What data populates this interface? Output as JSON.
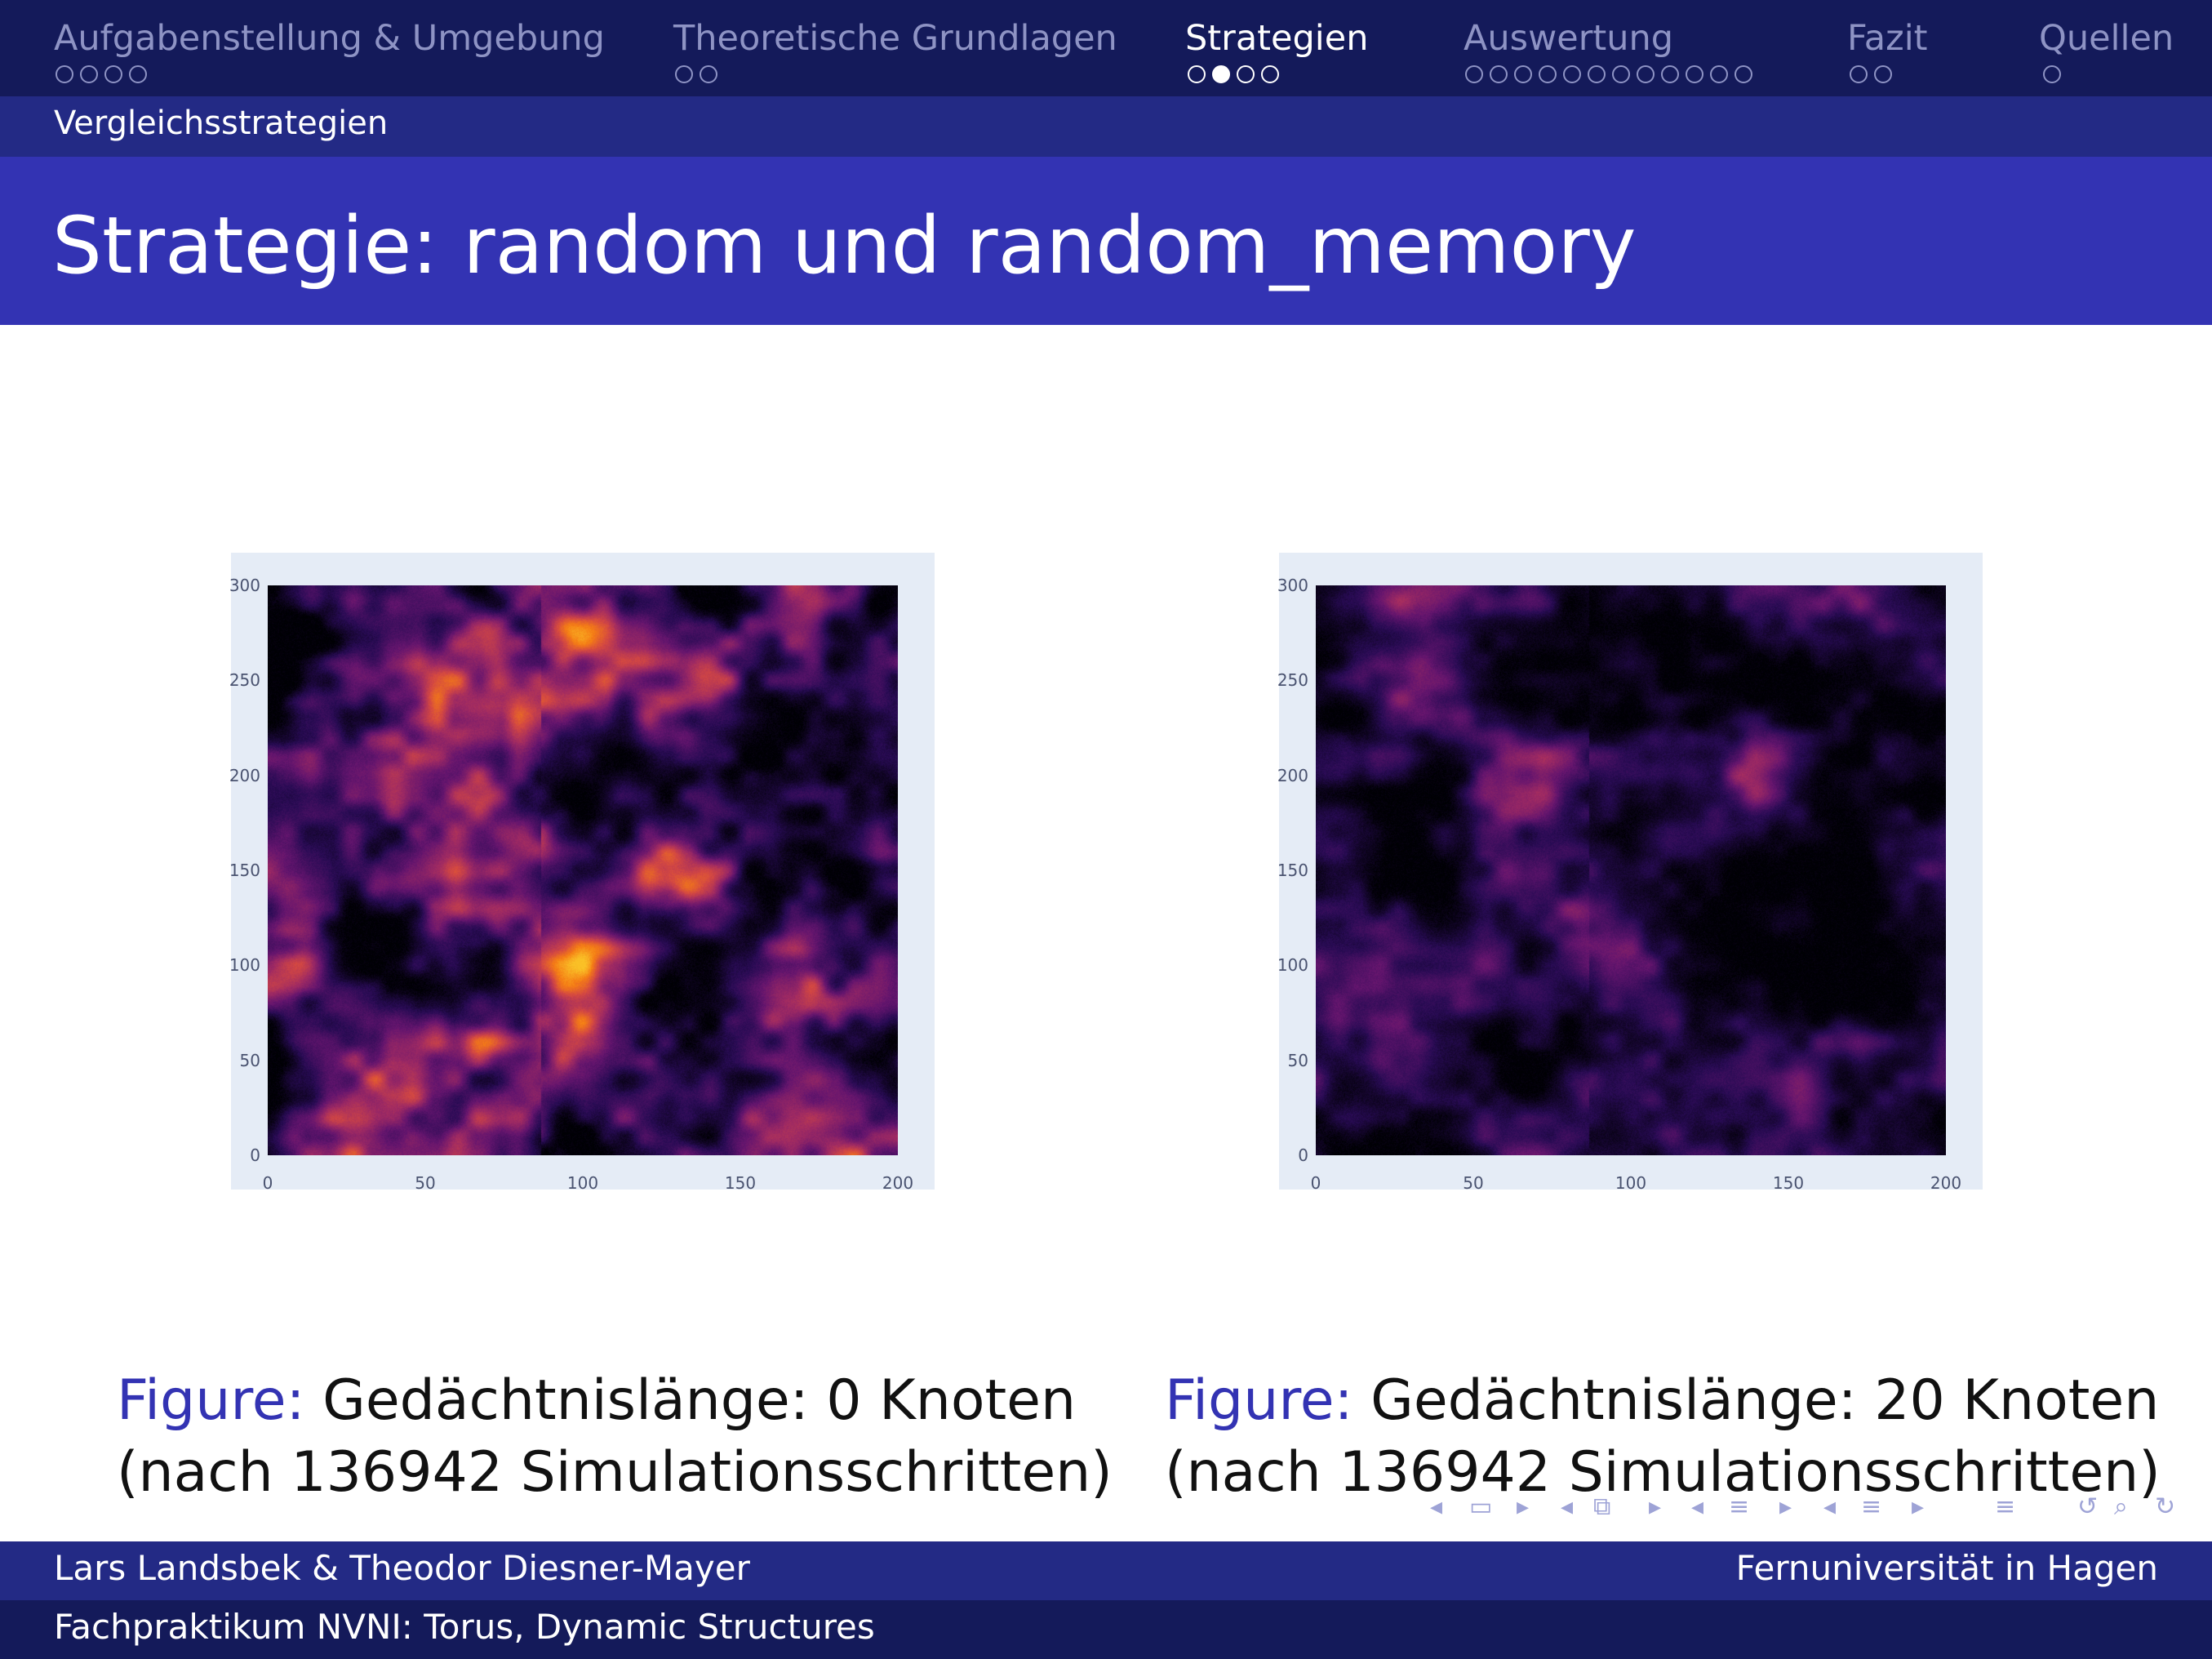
{
  "nav": {
    "sections": [
      {
        "label": "Aufgabenstellung & Umgebung",
        "dots": 4,
        "filled": -1,
        "active": false
      },
      {
        "label": "Theoretische Grundlagen",
        "dots": 2,
        "filled": -1,
        "active": false
      },
      {
        "label": "Strategien",
        "dots": 4,
        "filled": 1,
        "active": true
      },
      {
        "label": "Auswertung",
        "dots": 12,
        "filled": -1,
        "active": false
      },
      {
        "label": "Fazit",
        "dots": 2,
        "filled": -1,
        "active": false
      },
      {
        "label": "Quellen",
        "dots": 1,
        "filled": -1,
        "active": false
      }
    ],
    "subsection": "Vergleichsstrategien"
  },
  "slide": {
    "title": "Strategie: random und random_memory"
  },
  "figures": [
    {
      "caption_label": "Figure:",
      "caption_line1": "Gedächtnislänge: 0 Knoten",
      "caption_line2": "(nach 136942 Simulationsschritten)"
    },
    {
      "caption_label": "Figure:",
      "caption_line1": "Gedächtnislänge: 20 Knoten",
      "caption_line2": "(nach 136942 Simulationsschritten)"
    }
  ],
  "chart_data": [
    {
      "type": "heatmap",
      "x_ticks": [
        "0",
        "50",
        "100",
        "150",
        "200"
      ],
      "y_ticks": [
        "0",
        "50",
        "100",
        "150",
        "200",
        "250",
        "300"
      ],
      "xlim": [
        0,
        200
      ],
      "ylim": [
        0,
        300
      ],
      "colorscale": "inferno",
      "grid": true
    },
    {
      "type": "heatmap",
      "x_ticks": [
        "0",
        "50",
        "100",
        "150",
        "200"
      ],
      "y_ticks": [
        "0",
        "50",
        "100",
        "150",
        "200",
        "250",
        "300"
      ],
      "xlim": [
        0,
        200
      ],
      "ylim": [
        0,
        300
      ],
      "colorscale": "inferno",
      "grid": true
    }
  ],
  "footer": {
    "authors": "Lars Landsbek & Theodor Diesner-Mayer",
    "institution": "Fernuniversität in Hagen",
    "course": "Fachpraktikum NVNI: Torus, Dynamic Structures"
  },
  "colors": {
    "nav_dark": "#141a5a",
    "nav_mid": "#232a85",
    "title_band": "#3333b3",
    "plot_bg": "#e5ecf6"
  },
  "icons": [
    "nav-left-icon",
    "frame-icon",
    "nav-right-icon",
    "section-icon",
    "subsection-icon",
    "search-icon",
    "undo-icon"
  ]
}
